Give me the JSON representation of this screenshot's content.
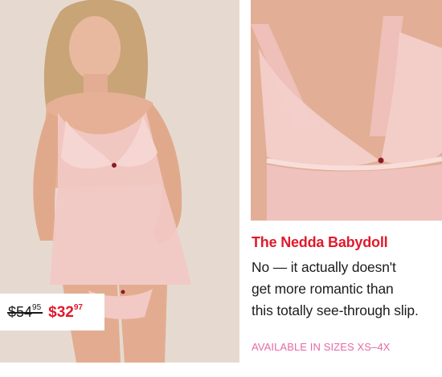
{
  "product": {
    "title": "The Nedda Babydoll",
    "description_lines": [
      "No — it actually doesn't",
      "get more romantic than",
      "this totally see-through slip."
    ],
    "sizes_note": "AVAILABLE IN SIZES XS–4X"
  },
  "price": {
    "original_whole": "$54",
    "original_cents": "95",
    "sale_whole": "$32",
    "sale_cents": "97"
  },
  "images": {
    "main": "model-wearing-babydoll-photo",
    "detail": "lace-bodice-closeup-photo"
  },
  "colors": {
    "accent_red": "#e01a2c",
    "accent_pink": "#e46aa6",
    "fabric_pink": "#f2c9c4",
    "backdrop": "#e9ddd4"
  }
}
